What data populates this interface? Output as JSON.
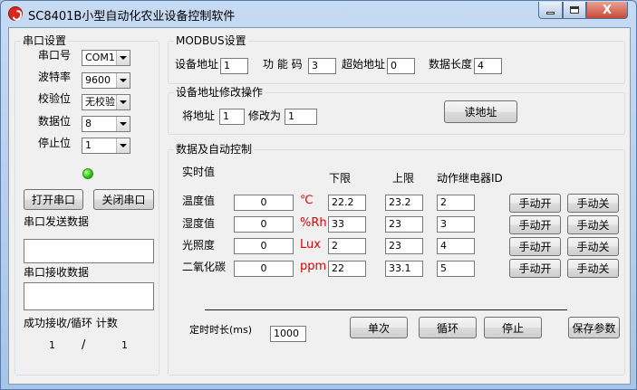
{
  "window": {
    "title": "SC8401B小型自动化农业设备控制软件",
    "close_glyph": "X"
  },
  "serial": {
    "group_title": "串口设置",
    "port_label": "串口号",
    "port_value": "COM1",
    "baud_label": "波特率",
    "baud_value": "9600",
    "parity_label": "校验位",
    "parity_value": "无校验",
    "databits_label": "数据位",
    "databits_value": "8",
    "stopbits_label": "停止位",
    "stopbits_value": "1",
    "open_button": "打开串口",
    "close_button": "关闭串口",
    "send_label": "串口发送数据",
    "send_value": "",
    "recv_label": "串口接收数据",
    "recv_value": "",
    "stats_label": "成功接收/循环 计数",
    "success_count": "1",
    "separator": "/",
    "loop_count": "1"
  },
  "modbus": {
    "group_title": "MODBUS设置",
    "device_addr_label": "设备地址",
    "device_addr": "1",
    "func_code_label": "功 能 码",
    "func_code": "3",
    "start_addr_label": "超始地址",
    "start_addr": "0",
    "data_len_label": "数据长度",
    "data_len": "4"
  },
  "addr_change": {
    "group_title": "设备地址修改操作",
    "from_label": "将地址",
    "from_value": "1",
    "to_label": "修改为",
    "to_value": "1",
    "read_button": "读地址"
  },
  "control": {
    "group_title": "数据及自动控制",
    "headers": {
      "realtime": "实时值",
      "lower": "下限",
      "upper": "上限",
      "relay": "动作继电器ID"
    },
    "rows": [
      {
        "name": "温度值",
        "value": "0",
        "unit": "℃",
        "lower": "22.2",
        "upper": "23.2",
        "relay": "2",
        "on": "手动开",
        "off": "手动关"
      },
      {
        "name": "湿度值",
        "value": "0",
        "unit": "%Rh",
        "lower": "33",
        "upper": "23",
        "relay": "3",
        "on": "手动开",
        "off": "手动关"
      },
      {
        "name": "光照度",
        "value": "0",
        "unit": "Lux",
        "lower": "2",
        "upper": "23",
        "relay": "4",
        "on": "手动开",
        "off": "手动关"
      },
      {
        "name": "二氧化碳",
        "value": "0",
        "unit": "ppm",
        "lower": "22",
        "upper": "33.1",
        "relay": "5",
        "on": "手动开",
        "off": "手动关"
      }
    ],
    "timer_label": "定时时长(ms)",
    "timer_value": "1000",
    "single_button": "单次",
    "loop_button": "循环",
    "stop_button": "停止",
    "save_button": "保存参数"
  },
  "colors": {
    "unit_red": "#e00000",
    "led_green": "#20c400"
  }
}
